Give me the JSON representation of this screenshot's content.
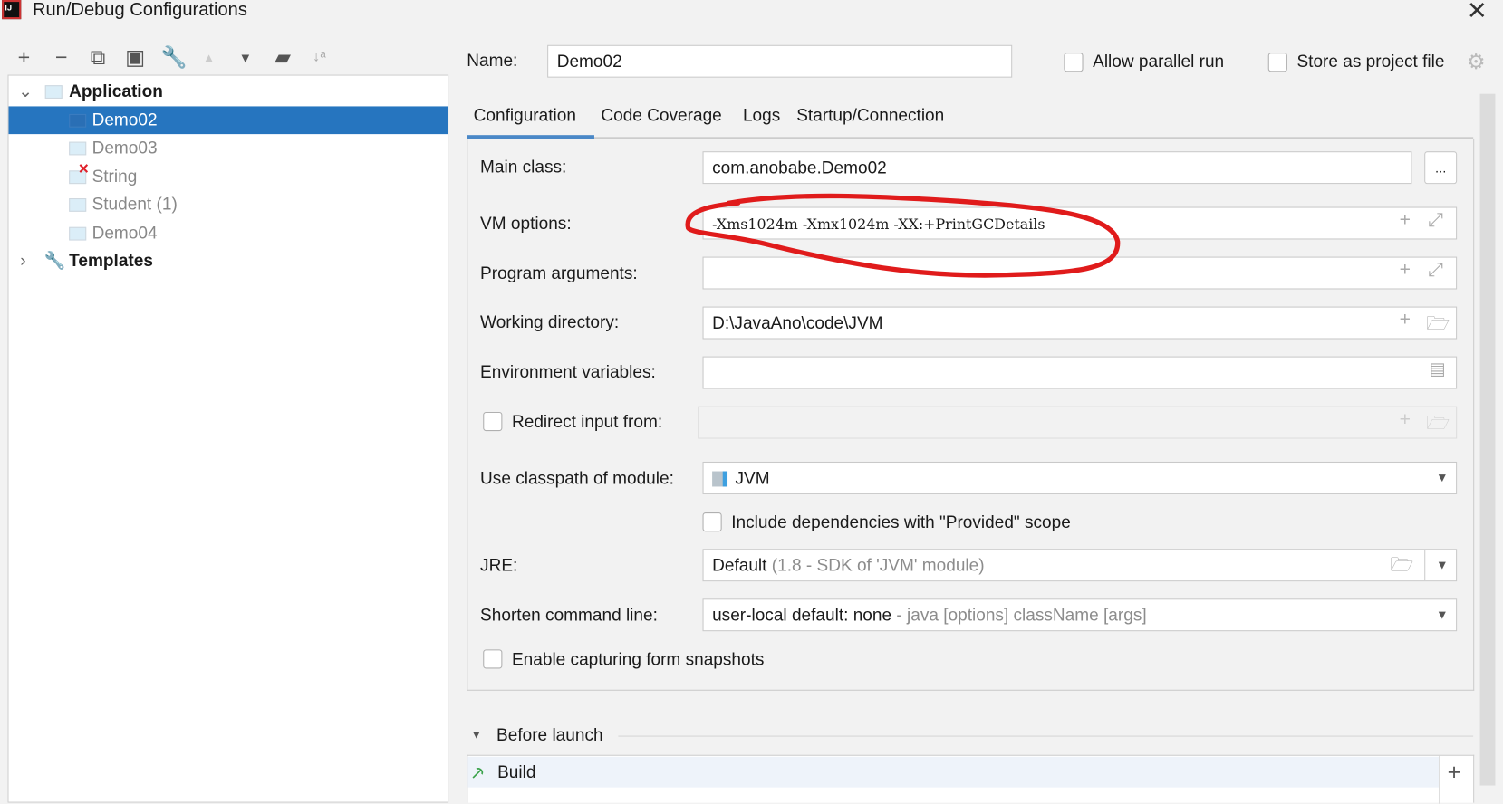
{
  "window": {
    "title": "Run/Debug Configurations"
  },
  "toolbar": {
    "icons": [
      "add-icon",
      "remove-icon",
      "copy-icon",
      "save-icon",
      "wrench-icon",
      "move-up-icon",
      "move-down-icon",
      "new-folder-icon",
      "sort-icon"
    ]
  },
  "tree": {
    "application": "Application",
    "items": [
      "Demo02",
      "Demo03",
      "String",
      "Student (1)",
      "Demo04"
    ],
    "templates": "Templates"
  },
  "header": {
    "name_label": "Name:",
    "name_value": "Demo02",
    "allow_parallel": "Allow parallel run",
    "store_project": "Store as project file"
  },
  "tabs": [
    "Configuration",
    "Code Coverage",
    "Logs",
    "Startup/Connection"
  ],
  "form": {
    "main_class_label": "Main class:",
    "main_class": "com.anobabe.Demo02",
    "browse": "...",
    "vm_label": "VM options:",
    "vm_value": "-Xms1024m -Xmx1024m -XX:+PrintGCDetails",
    "program_label": "Program arguments:",
    "program_value": "",
    "workdir_label": "Working directory:",
    "workdir_value": "D:\\JavaAno\\code\\JVM",
    "env_label": "Environment variables:",
    "env_value": "",
    "redirect_label": "Redirect input from:",
    "classpath_label": "Use classpath of module:",
    "classpath_value": "JVM",
    "include_deps": "Include dependencies with \"Provided\" scope",
    "jre_label": "JRE:",
    "jre_value": "Default",
    "jre_hint": "(1.8 - SDK of 'JVM' module)",
    "shorten_label": "Shorten command line:",
    "shorten_value": "user-local default: none",
    "shorten_hint": "- java [options] className [args]",
    "snapshots": "Enable capturing form snapshots"
  },
  "before_launch": {
    "title": "Before launch",
    "items": [
      "Build"
    ]
  },
  "colors": {
    "selection": "#2675bf",
    "annotation": "#e01b1b",
    "tab_underline": "#4a88c7"
  }
}
